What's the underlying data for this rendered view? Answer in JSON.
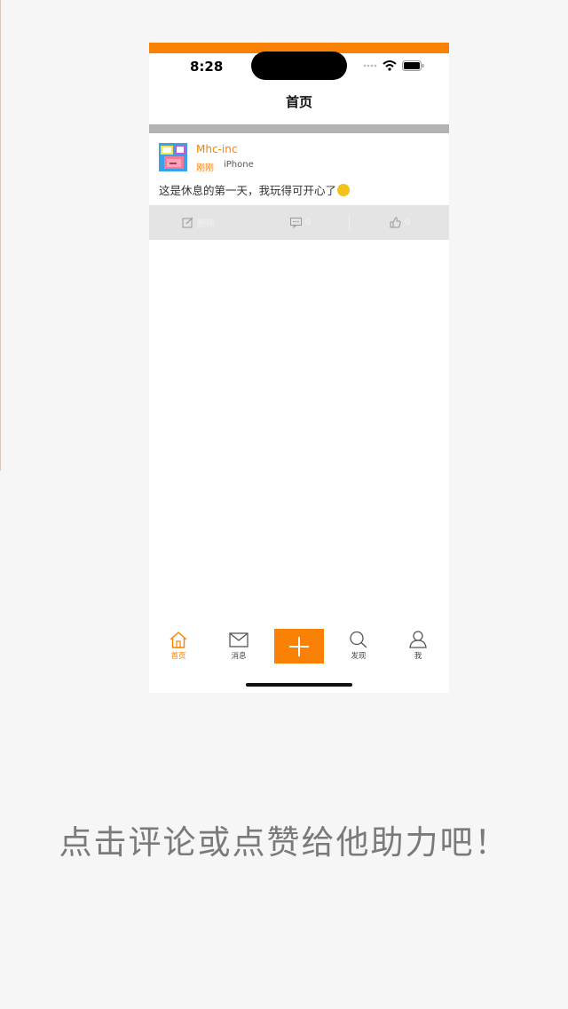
{
  "status_bar": {
    "time": "8:28"
  },
  "nav": {
    "title": "首页"
  },
  "post": {
    "username": "Mhc-inc",
    "time": "刚刚",
    "source": "iPhone",
    "text": "这是休息的第一天，我玩得可开心了"
  },
  "actions": {
    "delete_label": "删除",
    "comment_count": "0",
    "like_count": "0"
  },
  "tabs": [
    {
      "label": "首页",
      "icon": "home-icon",
      "active": true
    },
    {
      "label": "消息",
      "icon": "envelope-icon"
    },
    {
      "label": "发现",
      "icon": "search-icon"
    },
    {
      "label": "我",
      "icon": "profile-icon"
    }
  ],
  "caption": "点击评论或点赞给他助力吧！",
  "colors": {
    "accent": "#f98206",
    "action_bar": "#e4e4e4",
    "separator": "#b3b3b3"
  }
}
